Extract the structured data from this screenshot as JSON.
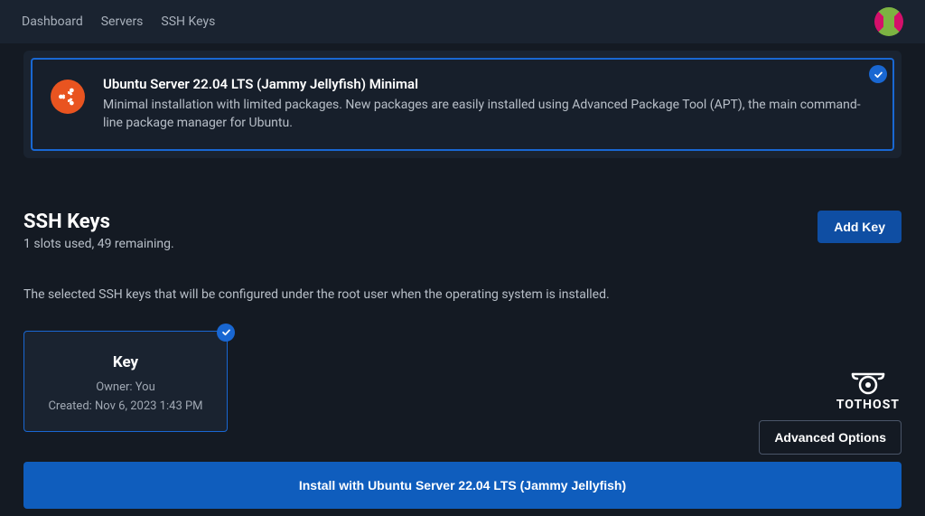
{
  "nav": {
    "dashboard": "Dashboard",
    "servers": "Servers",
    "sshkeys": "SSH Keys"
  },
  "os": {
    "title": "Ubuntu Server 22.04 LTS (Jammy Jellyfish) Minimal",
    "desc": "Minimal installation with limited packages. New packages are easily installed using Advanced Package Tool (APT), the main command-line package manager for Ubuntu."
  },
  "ssh_section": {
    "title": "SSH Keys",
    "slots": "1 slots used, 49 remaining.",
    "note": "The selected SSH keys that will be configured under the root user when the operating system is installed.",
    "add_key_label": "Add Key"
  },
  "key": {
    "name": "Key",
    "owner": "Owner: You",
    "created": "Created: Nov 6, 2023 1:43 PM"
  },
  "brand": {
    "name": "TOTHOST"
  },
  "footer": {
    "advanced": "Advanced Options",
    "install": "Install with Ubuntu Server 22.04 LTS (Jammy Jellyfish)"
  }
}
